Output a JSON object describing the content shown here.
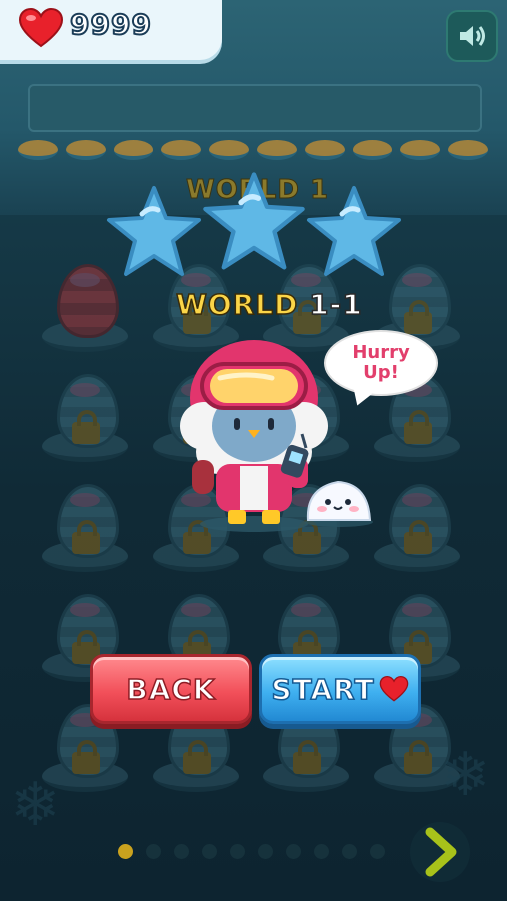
{
  "hud": {
    "hearts": "9999",
    "sound_icon": "speaker-icon"
  },
  "levels_background": {
    "title": "WORLD 1"
  },
  "popup": {
    "stars_earned": 0,
    "stars_total": 3,
    "title_word": "WORLD",
    "title_num": "1-1",
    "speech_line1": "Hurry",
    "speech_line2": "Up!"
  },
  "buttons": {
    "back_label": "BACK",
    "start_label": "START"
  },
  "pager": {
    "current_page": 1,
    "total_pages": 10
  },
  "colors": {
    "title_yellow": "#fbd548",
    "back_red": "#f2505a",
    "start_blue": "#3fb0f0",
    "star_blue": "#5fb8e6",
    "bubble_text": "#e23f6c"
  }
}
